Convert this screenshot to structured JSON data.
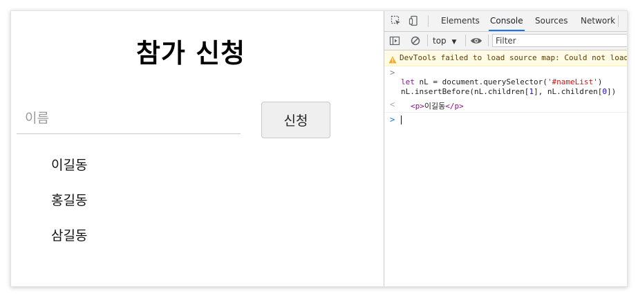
{
  "page": {
    "title": "참가 신청",
    "name_input_placeholder": "이름",
    "submit_label": "신청",
    "names": [
      "이길동",
      "홍길동",
      "삼길동"
    ]
  },
  "devtools": {
    "tabs": [
      {
        "label": "Elements",
        "active": false
      },
      {
        "label": "Console",
        "active": true
      },
      {
        "label": "Sources",
        "active": false
      },
      {
        "label": "Network",
        "active": false
      }
    ],
    "context_label": "top",
    "filter_placeholder": "Filter",
    "warning_text": "DevTools failed to load source map: Could not load",
    "command_prompt": ">",
    "code": {
      "line1_kw": "let",
      "line1_a": " nL = document.querySelector(",
      "line1_str": "'#nameList'",
      "line1_b": ")",
      "line2_a": "nL.insertBefore(nL.children[",
      "line2_n1": "1",
      "line2_b": "], nL.children[",
      "line2_n2": "0",
      "line2_c": "])"
    },
    "result_prompt": "<",
    "result": {
      "open_tag": "<p>",
      "text": "이길동",
      "close_tag": "</p>"
    },
    "input_prompt": ">",
    "colors": {
      "accent": "#1a73e8",
      "warning_bg": "#fffbe5",
      "keyword": "#881391",
      "string": "#c41a16",
      "number": "#1c00cf"
    }
  }
}
